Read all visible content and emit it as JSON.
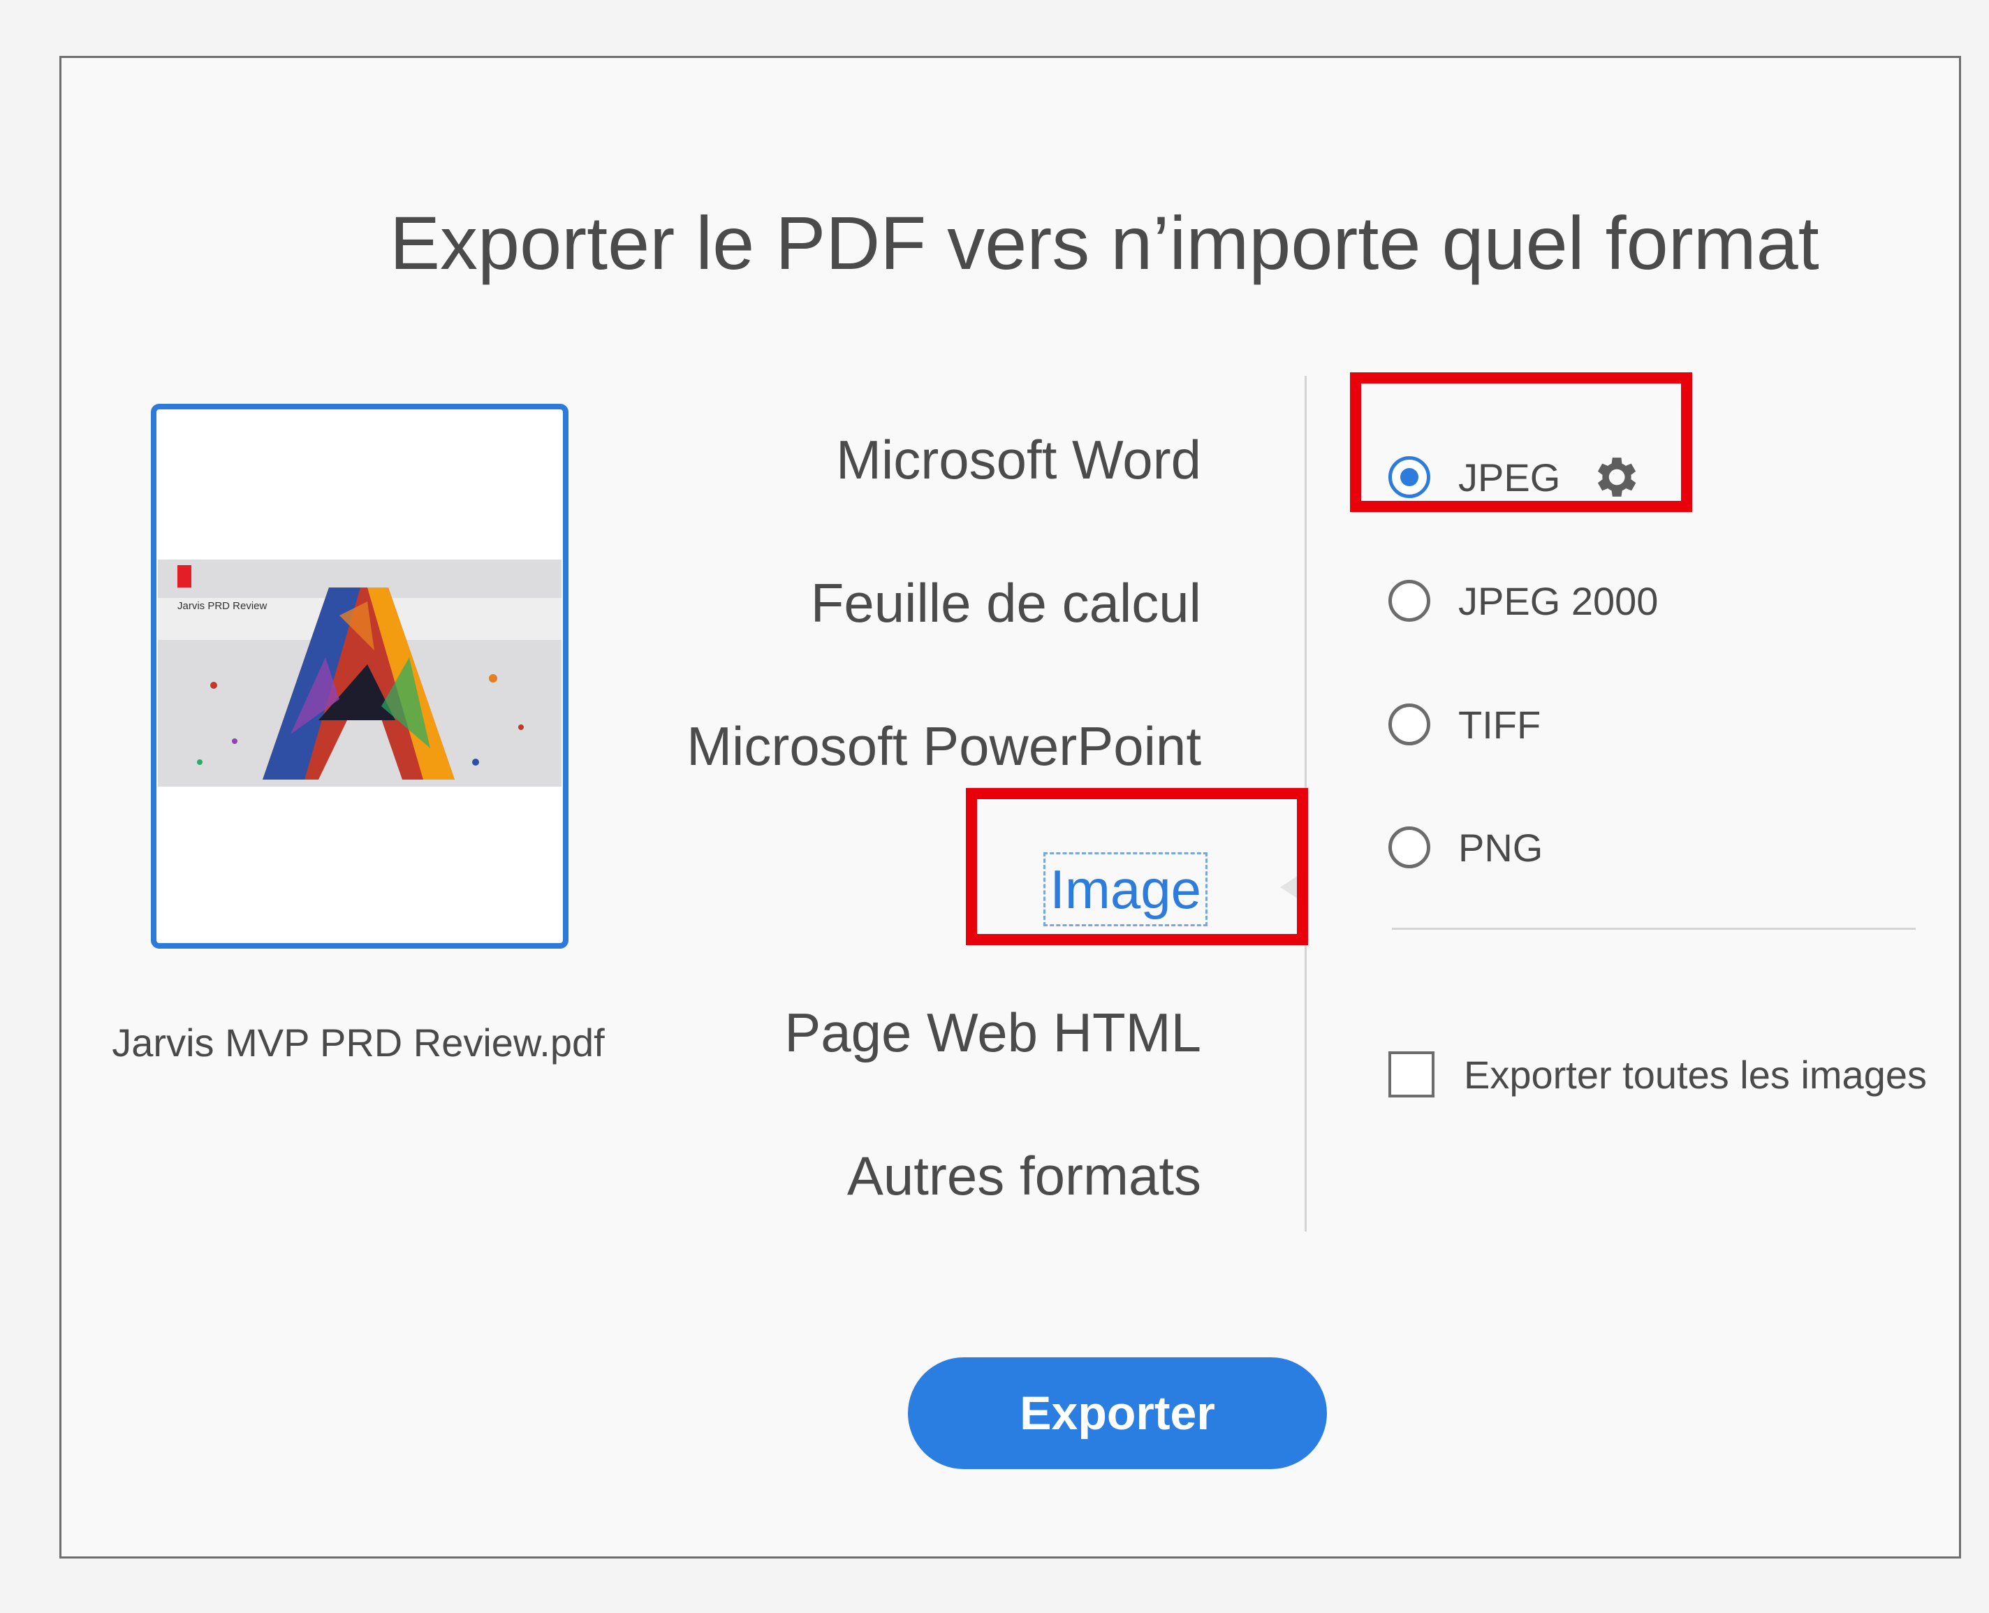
{
  "dialog": {
    "title": "Exporter le PDF vers n’importe quel format"
  },
  "document": {
    "filename": "Jarvis MVP PRD Review.pdf",
    "thumbnail_title": "Jarvis PRD Review"
  },
  "formats": {
    "items": [
      {
        "label": "Microsoft Word",
        "active": false
      },
      {
        "label": "Feuille de calcul",
        "active": false
      },
      {
        "label": "Microsoft PowerPoint",
        "active": false
      },
      {
        "label": "Image",
        "active": true
      },
      {
        "label": "Page Web HTML",
        "active": false
      },
      {
        "label": "Autres formats",
        "active": false
      }
    ]
  },
  "image_options": {
    "types": [
      {
        "label": "JPEG",
        "selected": true,
        "has_settings_icon": true,
        "icon": "gear-icon"
      },
      {
        "label": "JPEG 2000",
        "selected": false
      },
      {
        "label": "TIFF",
        "selected": false
      },
      {
        "label": "PNG",
        "selected": false
      }
    ],
    "export_all_images": {
      "label": "Exporter toutes les images",
      "checked": false
    }
  },
  "export_button": {
    "label": "Exporter"
  },
  "colors": {
    "accent": "#2d7bdc",
    "highlight": "#e8000b",
    "text": "#4b4b4b"
  }
}
